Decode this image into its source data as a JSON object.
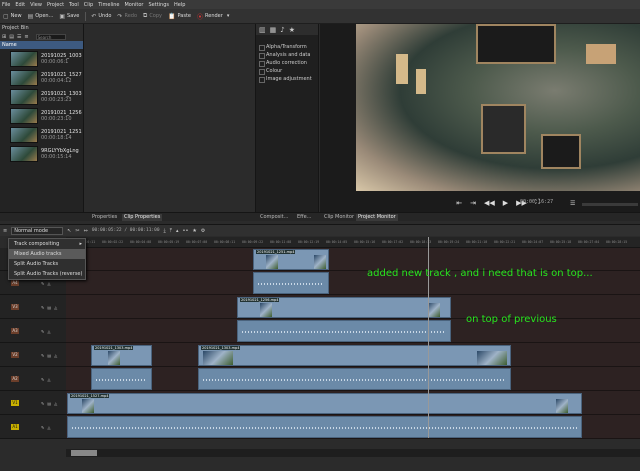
{
  "menu": [
    "File",
    "Edit",
    "View",
    "Project",
    "Tool",
    "Clip",
    "Timeline",
    "Monitor",
    "Settings",
    "Help"
  ],
  "toolbar": {
    "new": "New",
    "open": "Open...",
    "save": "Save",
    "undo": "Undo",
    "redo": "Redo",
    "copy": "Copy",
    "paste": "Paste",
    "render": "Render"
  },
  "bin": {
    "title": "Project Bin",
    "search_placeholder": "Search",
    "header": "Name",
    "clips": [
      {
        "name": "20191025_1003",
        "dur": "00:00:06:1"
      },
      {
        "name": "20191021_1527",
        "dur": "00:00:04:12"
      },
      {
        "name": "20191021_1303",
        "dur": "00:00:23:23"
      },
      {
        "name": "20191021_1256",
        "dur": "00:00:23:10"
      },
      {
        "name": "20191021_1251",
        "dur": "00:00:18:14"
      },
      {
        "name": "9RGLYYbXgLng",
        "dur": "00:00:15:14"
      }
    ]
  },
  "effects": [
    "Alpha/Transform",
    "Analysis and data",
    "Audio correction",
    "Colour",
    "Image adjustment"
  ],
  "tabs": {
    "properties": "Properties",
    "clip_properties": "Clip Properties",
    "composition": "Composit...",
    "effects": "Effe...",
    "clip_monitor": "Clip Monitor",
    "project_monitor": "Project Monitor"
  },
  "monitor": {
    "timecode": "00:00:16:27"
  },
  "timeline": {
    "mode": "Normal mode",
    "timecode": "00:00:05:22 / 00:00:11:00",
    "ruler": [
      "00:00:00:11",
      "00:00:02:22",
      "00:00:04:08",
      "00:00:05:19",
      "00:00:07:00",
      "00:00:08:11",
      "00:00:09:22",
      "00:00:11:08",
      "00:00:12:19",
      "00:00:14:05",
      "00:00:15:16",
      "00:00:17:02",
      "00:00:18:13",
      "00:00:19:24",
      "00:00:21:10",
      "00:00:22:21",
      "00:00:24:07",
      "00:00:25:18",
      "00:00:27:04",
      "00:00:28:15"
    ],
    "tracks": [
      "V4",
      "A4",
      "V3",
      "A3",
      "V2",
      "A2",
      "V1",
      "A1"
    ]
  },
  "context_menu": {
    "items": [
      "Track compositing",
      "Mixed Audio tracks",
      "Split Audio Tracks",
      "Split Audio Tracks (reverse)"
    ],
    "highlighted": 1
  },
  "annotations": {
    "line1": "added new track , and i need that is on top...",
    "line2": "on top of previous"
  },
  "clip_labels": {
    "c1": "20191021_1251.mp4",
    "c2": "20191021_1256.mp4",
    "c3": "20191021_1303.mp4",
    "c4": "20191021_1303.mp4",
    "c5": "20191021_1527.mp4"
  }
}
